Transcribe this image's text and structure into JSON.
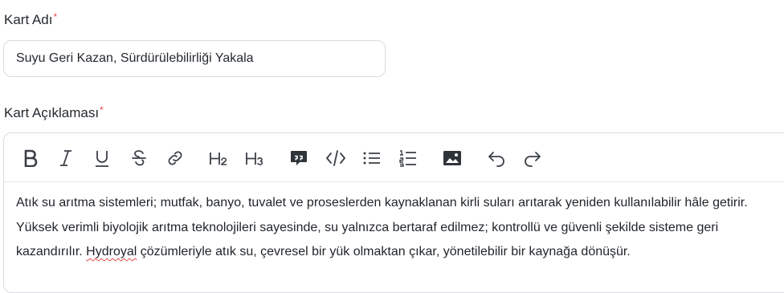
{
  "card_name": {
    "label": "Kart Adı",
    "required_mark": "*",
    "value": "Suyu Geri Kazan, Sürdürülebilirliği Yakala"
  },
  "card_description": {
    "label": "Kart Açıklaması",
    "required_mark": "*",
    "text_before": "Atık su arıtma sistemleri; mutfak, banyo, tuvalet ve proseslerden kaynaklanan kirli suları arıtarak yeniden kullanılabilir hâle getirir. Yüksek verimli biyolojik arıtma teknolojileri sayesinde, su yalnızca bertaraf edilmez; kontrollü ve güvenli şekilde sisteme geri kazandırılır. ",
    "misspelled": "Hydroyal",
    "text_after": " çözümleriyle atık su, çevresel bir yük olmaktan çıkar, yönetilebilir bir kaynağa dönüşür."
  },
  "toolbar": {
    "items": [
      "bold-icon",
      "italic-icon",
      "underline-icon",
      "strikethrough-icon",
      "link-icon",
      "heading-2-icon",
      "heading-3-icon",
      "quote-icon",
      "code-icon",
      "bullet-list-icon",
      "ordered-list-icon",
      "image-icon",
      "undo-icon",
      "redo-icon"
    ]
  },
  "colors": {
    "required": "#e5484d",
    "border": "#d9dbe0",
    "text": "#1f2328"
  }
}
